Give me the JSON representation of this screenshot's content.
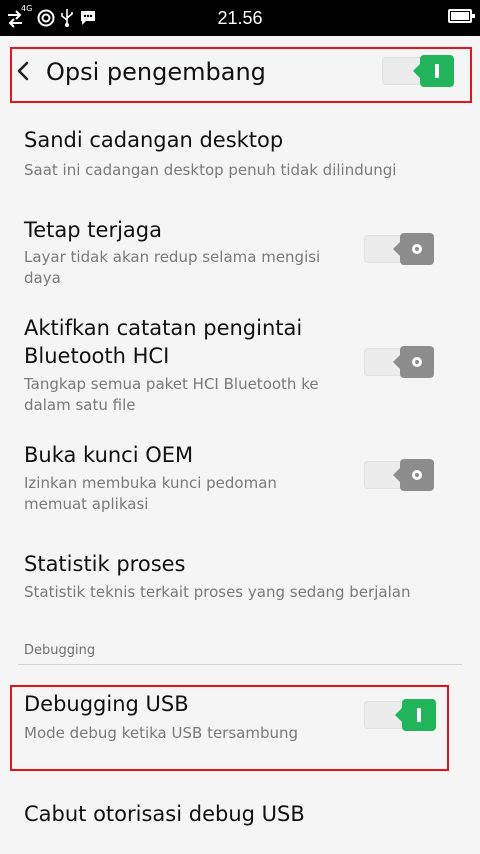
{
  "status_bar": {
    "time": "21.56",
    "network_label": "4G",
    "icons": [
      "data-transfer-icon",
      "vpn-icon",
      "usb-icon",
      "chat-icon",
      "battery-icon"
    ]
  },
  "app_bar": {
    "title": "Opsi pengembang",
    "master_toggle_on": true
  },
  "settings": [
    {
      "title": "Sandi cadangan desktop",
      "summary": "Saat ini cadangan desktop penuh tidak dilindungi"
    },
    {
      "title": "Tetap terjaga",
      "summary_lines": [
        "Layar tidak akan redup selama mengisi",
        "daya"
      ],
      "toggle_on": false
    },
    {
      "title_lines": [
        "Aktifkan catatan pengintai",
        "Bluetooth HCI"
      ],
      "summary_lines": [
        "Tangkap semua paket HCI Bluetooth ke",
        "dalam satu file"
      ],
      "toggle_on": false
    },
    {
      "title": "Buka kunci OEM",
      "summary_lines": [
        "Izinkan membuka kunci pedoman",
        "memuat aplikasi"
      ],
      "toggle_on": false
    },
    {
      "title": "Statistik proses",
      "summary": "Statistik teknis terkait proses yang sedang berjalan"
    }
  ],
  "debugging_section": {
    "header": "Debugging",
    "items": [
      {
        "title": "Debugging USB",
        "summary": "Mode debug ketika USB tersambung",
        "toggle_on": true
      },
      {
        "title": "Cabut otorisasi debug USB"
      }
    ]
  },
  "colors": {
    "toggle_on": "#21b45a",
    "toggle_off": "#8d8d8d",
    "highlight": "#e0161d"
  }
}
